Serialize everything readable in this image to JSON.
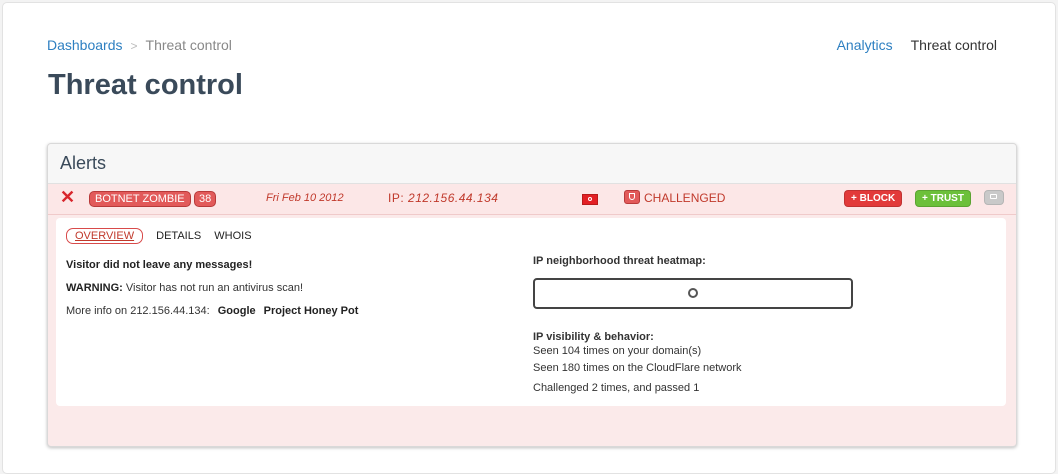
{
  "breadcrumb": {
    "root": "Dashboards",
    "current": "Threat control"
  },
  "topnav": {
    "analytics": "Analytics",
    "current": "Threat control"
  },
  "page_title": "Threat control",
  "alerts": {
    "header": "Alerts",
    "row": {
      "close_icon": "close-x-icon",
      "tag": "BOTNET ZOMBIE",
      "count": "38",
      "date": "Fri Feb 10 2012",
      "ip_label": "IP:",
      "ip": "212.156.44.134",
      "flag_icon": "turkey-flag-icon",
      "status_icon": "shield-icon",
      "status": "CHALLENGED",
      "block_label": "+ BLOCK",
      "trust_label": "+ TRUST",
      "more_icon": "folder-icon"
    },
    "tabs": [
      "OVERVIEW",
      "DETAILS",
      "WHOIS"
    ],
    "overview": {
      "messages": "Visitor did not leave any messages!",
      "warning_label": "WARNING:",
      "warning_text": "Visitor has not run an antivirus scan!",
      "more_info": "More info on 212.156.44.134:",
      "link_google": "Google",
      "link_honeypot": "Project Honey Pot"
    },
    "heatmap_title": "IP neighborhood threat heatmap:",
    "visibility_title": "IP visibility & behavior:",
    "visibility_lines": [
      "Seen 104 times on your domain(s)",
      "Seen 180 times on the CloudFlare network",
      "Challenged 2 times, and passed 1"
    ]
  },
  "colors": {
    "accent": "#2d7fc1",
    "danger": "#e23a3a",
    "success": "#6cc03a",
    "title": "#3a4a5a"
  }
}
